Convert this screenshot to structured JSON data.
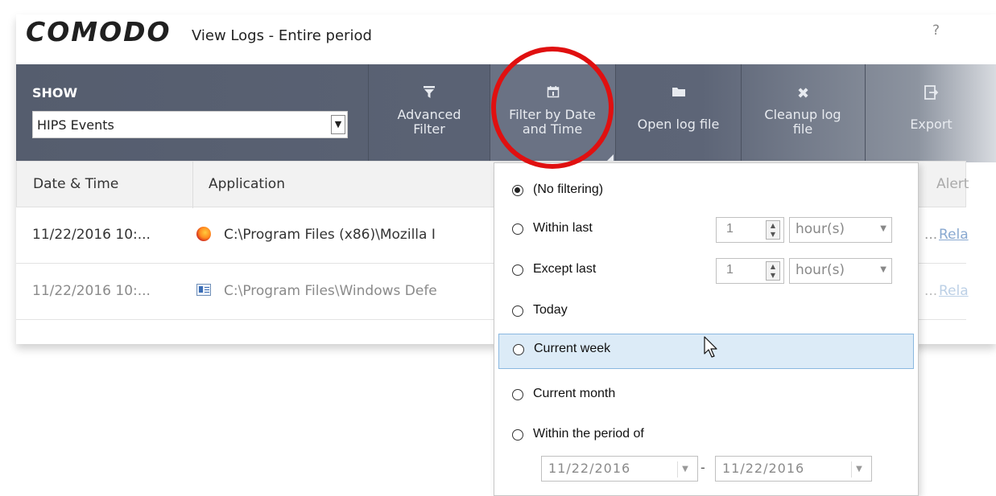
{
  "window": {
    "logo": "COMODO",
    "title": "View Logs - Entire period",
    "help": "?"
  },
  "toolbar": {
    "show_label": "SHOW",
    "show_value": "HIPS Events",
    "buttons": [
      {
        "label": "Advanced Filter",
        "icon": "funnel-icon"
      },
      {
        "label": "Filter by Date and Time",
        "icon": "calendar-icon"
      },
      {
        "label": "Open log file",
        "icon": "folder-icon"
      },
      {
        "label": "Cleanup log file",
        "icon": "x-icon"
      },
      {
        "label": "Export",
        "icon": "export-icon"
      }
    ]
  },
  "grid": {
    "headers": [
      "Date & Time",
      "Application",
      "Alert"
    ],
    "rows": [
      {
        "date": "11/22/2016 10:...",
        "app": "C:\\Program Files (x86)\\Mozilla I",
        "target": "...",
        "link": "Rela"
      },
      {
        "date": "11/22/2016 10:...",
        "app": "C:\\Program Files\\Windows Defe",
        "target": "...",
        "link": "Rela"
      }
    ]
  },
  "filter_menu": {
    "options": [
      {
        "label": "(No filtering)",
        "selected": true
      },
      {
        "label": "Within last",
        "value": "1",
        "unit": "hour(s)"
      },
      {
        "label": "Except last",
        "value": "1",
        "unit": "hour(s)"
      },
      {
        "label": "Today"
      },
      {
        "label": "Current week",
        "highlighted": true
      },
      {
        "label": "Current month"
      },
      {
        "label": "Within the period of"
      }
    ],
    "period_from": "11/22/2016",
    "period_separator": "-",
    "period_to": "11/22/2016"
  },
  "colors": {
    "toolbar": "#5d6577",
    "highlight": "#dcebf7",
    "annotation": "#e01010"
  }
}
